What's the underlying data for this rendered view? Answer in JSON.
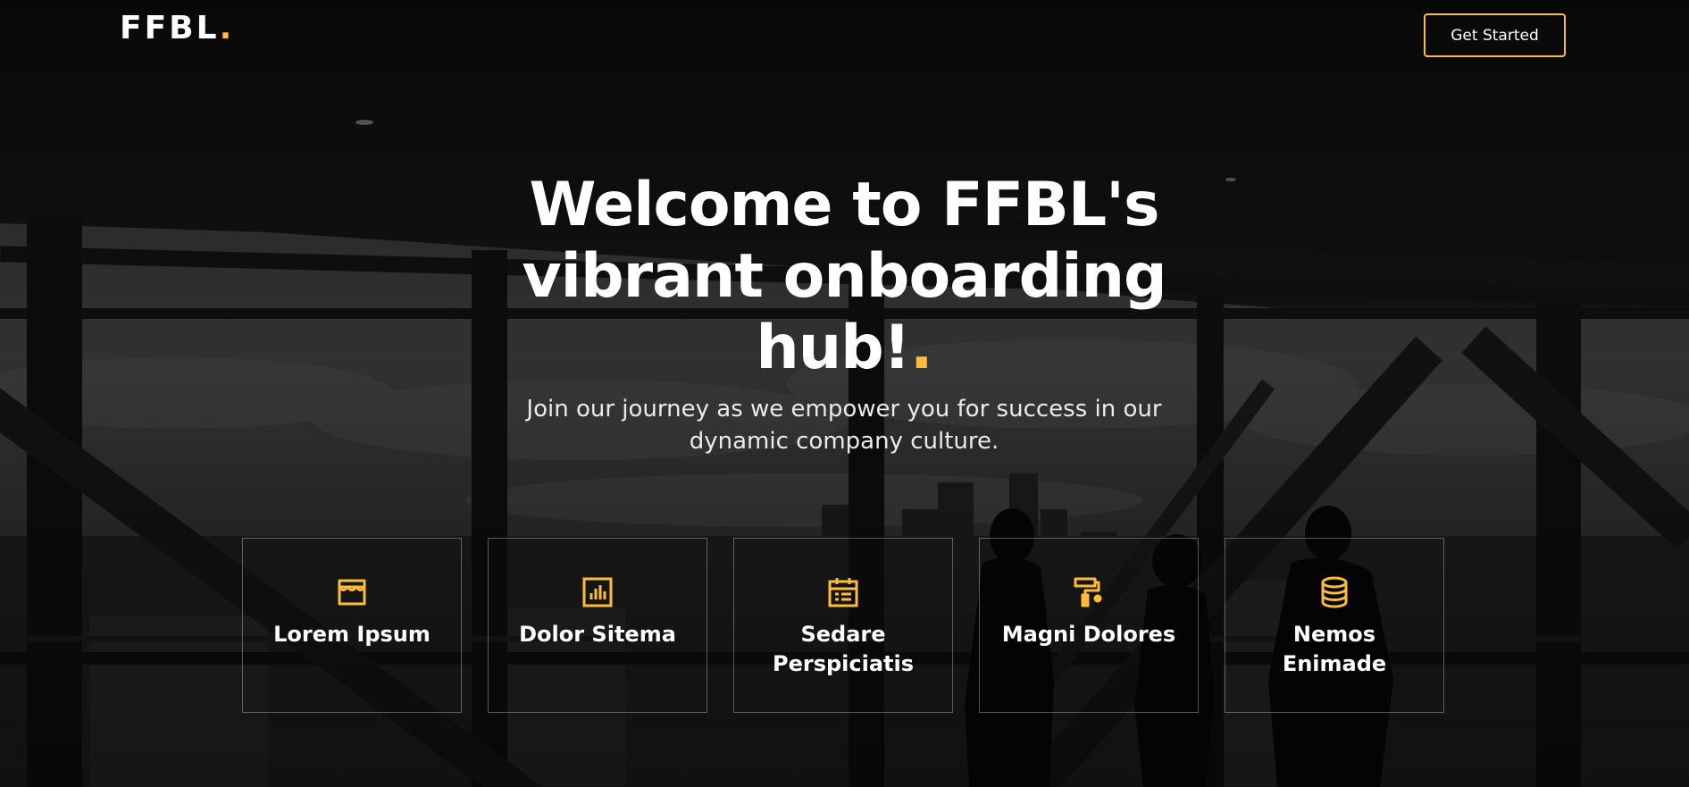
{
  "header": {
    "logo_text": "FFBL",
    "logo_dot": ".",
    "cta_label": "Get Started"
  },
  "hero": {
    "title_line1": "Welcome to FFBL's",
    "title_line2": "vibrant onboarding",
    "title_line3": "hub!",
    "title_dot": ".",
    "subtitle": "Join our journey as we empower you for success in our dynamic company culture."
  },
  "features": [
    {
      "label": "Lorem Ipsum",
      "icon": "store-icon"
    },
    {
      "label": "Dolor Sitema",
      "icon": "bar-chart-icon"
    },
    {
      "label": "Sedare Perspiciatis",
      "icon": "calendar-icon"
    },
    {
      "label": "Magni Dolores",
      "icon": "paint-roller-icon"
    },
    {
      "label": "Nemos Enimade",
      "icon": "database-icon"
    }
  ],
  "colors": {
    "accent": "#febc3b",
    "text": "#ffffff",
    "overlay": "#0c0c0c"
  }
}
